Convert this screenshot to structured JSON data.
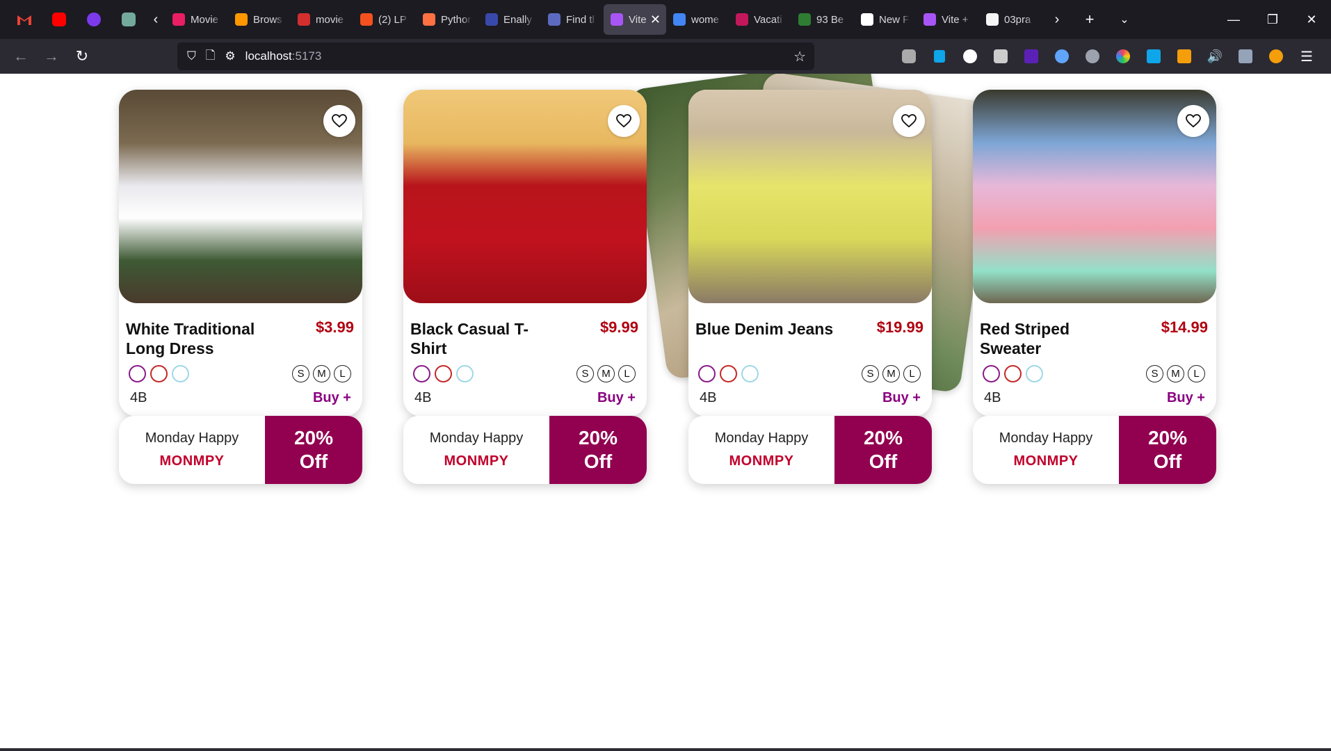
{
  "browser": {
    "tabs": [
      {
        "label": "Movie",
        "color": "#e91e63"
      },
      {
        "label": "Brows",
        "color": "#ff9800"
      },
      {
        "label": "movie",
        "color": "#d32f2f"
      },
      {
        "label": "(2) LP",
        "color": "#f4511e"
      },
      {
        "label": "Pythor",
        "color": "#ff7043"
      },
      {
        "label": "Enally",
        "color": "#3949ab"
      },
      {
        "label": "Find tl",
        "color": "#5c6bc0"
      },
      {
        "label": "Vite",
        "color": "#a855f7",
        "active": true
      },
      {
        "label": "wome",
        "color": "#4285f4"
      },
      {
        "label": "Vacati",
        "color": "#c2185b"
      },
      {
        "label": "93 Be",
        "color": "#2e7d32"
      },
      {
        "label": "New F",
        "color": "#ffffff"
      },
      {
        "label": "Vite +",
        "color": "#a855f7"
      },
      {
        "label": "03pra",
        "color": "#f5f5f5"
      }
    ],
    "url_host": "localhost",
    "url_port": ":5173"
  },
  "products": [
    {
      "title": "White Traditional Long Dress",
      "price": "$3.99",
      "stock": "4B",
      "buy": "Buy +",
      "sizes": [
        "S",
        "M",
        "L"
      ],
      "colors": [
        "#8a1a8a",
        "#c62828",
        "#9fd8e6"
      ]
    },
    {
      "title": "Black Casual T-Shirt",
      "price": "$9.99",
      "stock": "4B",
      "buy": "Buy +",
      "sizes": [
        "S",
        "M",
        "L"
      ],
      "colors": [
        "#8a1a8a",
        "#c62828",
        "#9fd8e6"
      ]
    },
    {
      "title": "Blue Denim Jeans",
      "price": "$19.99",
      "stock": "4B",
      "buy": "Buy +",
      "sizes": [
        "S",
        "M",
        "L"
      ],
      "colors": [
        "#8a1a8a",
        "#c62828",
        "#9fd8e6"
      ]
    },
    {
      "title": "Red Striped Sweater",
      "price": "$14.99",
      "stock": "4B",
      "buy": "Buy +",
      "sizes": [
        "S",
        "M",
        "L"
      ],
      "colors": [
        "#8a1a8a",
        "#c62828",
        "#9fd8e6"
      ]
    }
  ],
  "promo": {
    "text": "Monday Happy",
    "code": "MONMPY",
    "discount_line1": "20%",
    "discount_line2": "Off"
  },
  "colors": {
    "accent": "#920050",
    "price": "#b00010",
    "buy": "#8a0080"
  }
}
